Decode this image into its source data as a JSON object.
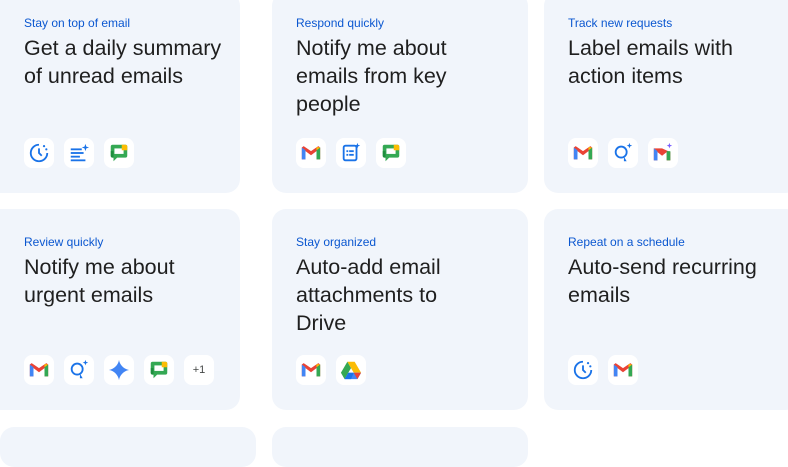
{
  "cards": [
    {
      "eyebrow": "Stay on top of email",
      "title": "Get a daily summary of unread emails",
      "icons": [
        "schedule-icon",
        "summary-list-icon",
        "google-chat-icon"
      ]
    },
    {
      "eyebrow": "Respond quickly",
      "title": "Notify me about emails from key people",
      "icons": [
        "gmail-icon",
        "form-icon",
        "google-chat-icon"
      ]
    },
    {
      "eyebrow": "Track new requests",
      "title": "Label emails with action items",
      "icons": [
        "gmail-icon",
        "ask-gemini-icon",
        "gmail-gemini-icon"
      ]
    },
    {
      "eyebrow": "Review quickly",
      "title": "Notify me about urgent emails",
      "icons": [
        "gmail-icon",
        "ask-gemini-icon",
        "gemini-spark-icon",
        "google-chat-icon"
      ],
      "more": "+1"
    },
    {
      "eyebrow": "Stay organized",
      "title": "Auto-add email attachments to Drive",
      "icons": [
        "gmail-icon",
        "google-drive-icon"
      ]
    },
    {
      "eyebrow": "Repeat on a schedule",
      "title": "Auto-send recurring emails",
      "icons": [
        "schedule-icon",
        "gmail-icon"
      ]
    }
  ],
  "colors": {
    "card_bg": "#f1f5fb",
    "eyebrow": "#0b57d0",
    "title": "#1f1f1f"
  }
}
